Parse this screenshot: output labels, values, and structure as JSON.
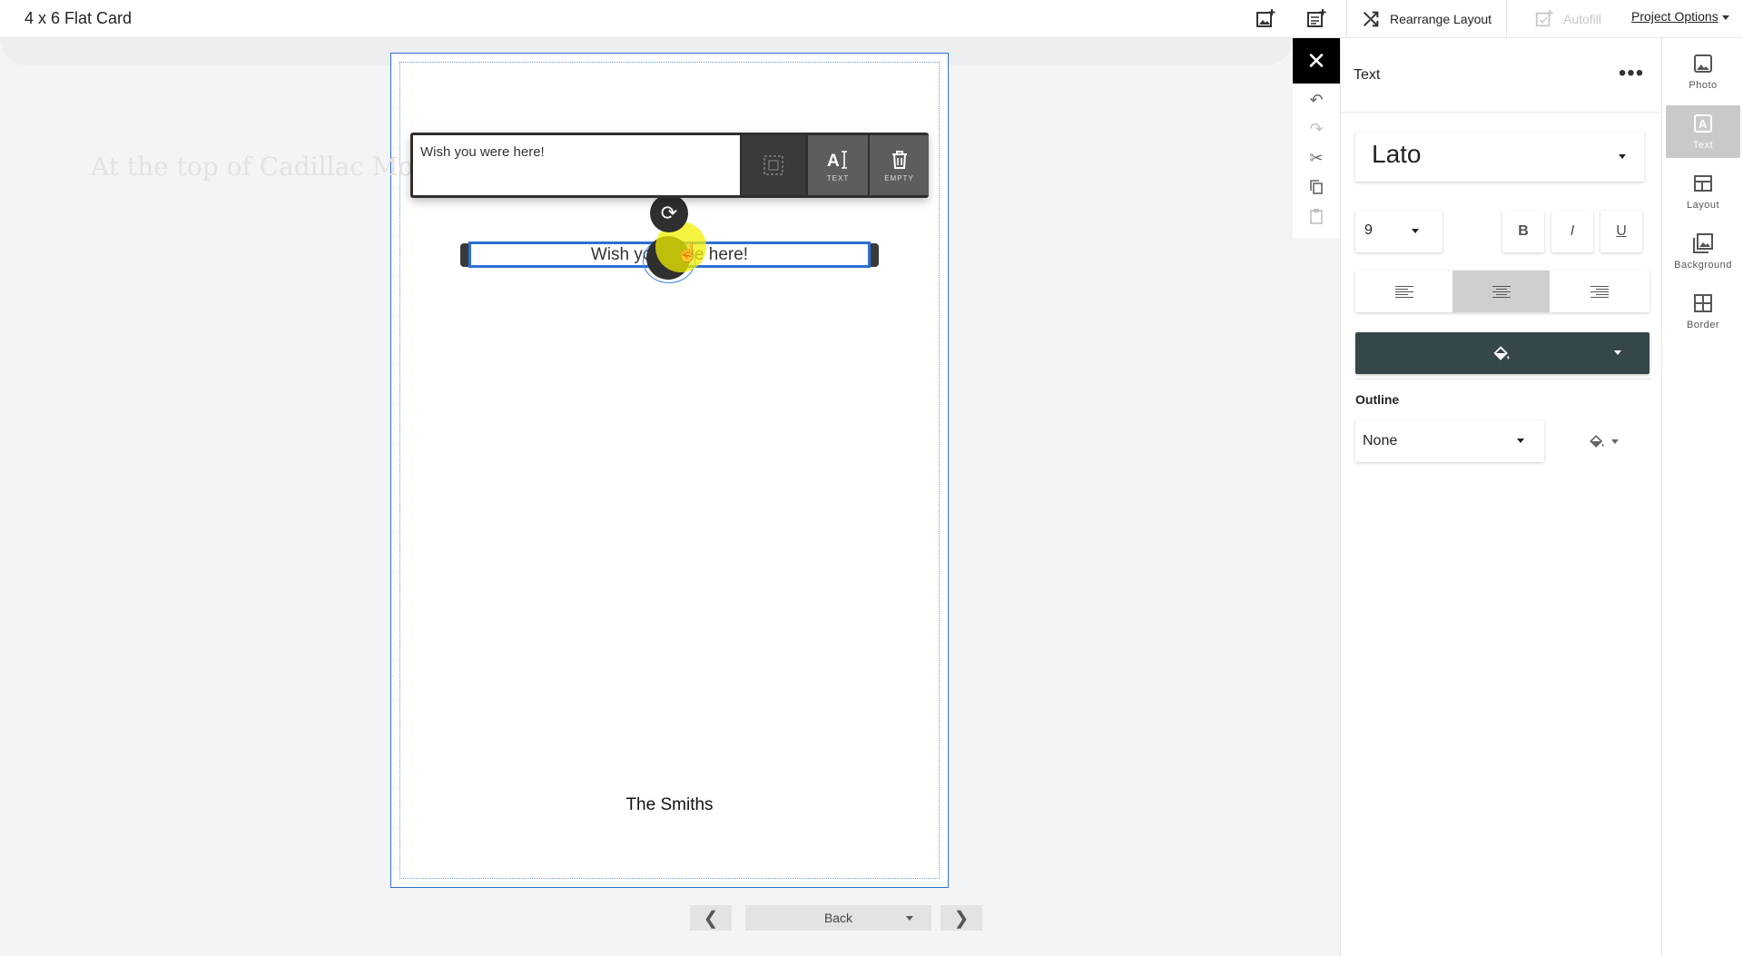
{
  "app": {
    "title": "4 x 6 Flat Card"
  },
  "toolbar": {
    "rearrange_label": "Rearrange Layout",
    "autofill_label": "Autofill",
    "project_options_label": "Project Options"
  },
  "card": {
    "ghost_heading": "At the top of Cadillac Mountain",
    "selected_text": "Wish you were here!",
    "signature": "The Smiths"
  },
  "text_toolbar": {
    "input_value": "Wish you were here!",
    "text_label": "TEXT",
    "empty_label": "EMPTY"
  },
  "page_nav": {
    "page_label": "Back"
  },
  "panel": {
    "title": "Text",
    "font_family": "Lato",
    "font_size": "9",
    "bold_label": "B",
    "italic_label": "I",
    "underline_label": "U",
    "outline_section": "Outline",
    "outline_value": "None",
    "active_alignment": "center",
    "text_color": "#36474a"
  },
  "rail": {
    "items": [
      {
        "label": "Photo",
        "icon": "photo-icon"
      },
      {
        "label": "Text",
        "icon": "text-icon",
        "active": true
      },
      {
        "label": "Layout",
        "icon": "layout-icon"
      },
      {
        "label": "Background",
        "icon": "background-icon"
      },
      {
        "label": "Border",
        "icon": "border-icon"
      }
    ]
  },
  "colors": {
    "selection": "#2c6fd6",
    "toolbar_dark": "#2e2e2e",
    "active_tab": "#c9c9c9"
  }
}
